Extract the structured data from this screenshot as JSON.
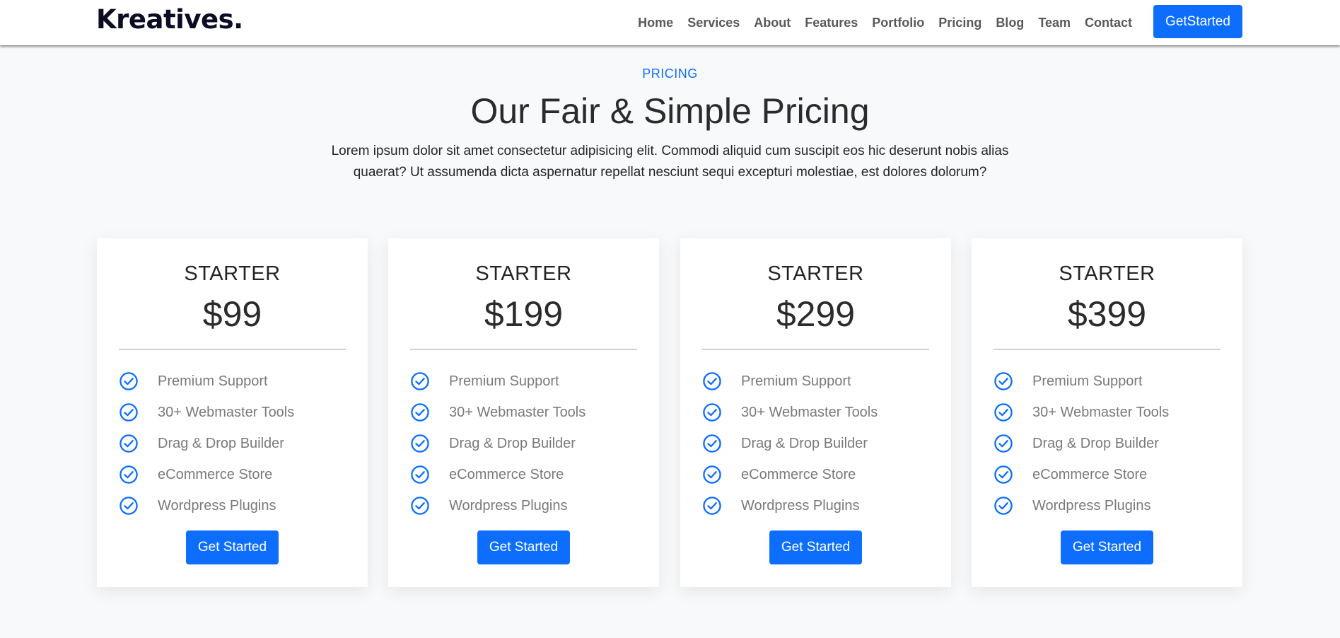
{
  "colors": {
    "accent": "#0d6efd",
    "nav_text": "#595959",
    "brand": "#0c0c24",
    "feature_text": "#7a7a7a",
    "background": "#f8f9fa"
  },
  "navbar": {
    "brand": "Kreatives.",
    "links": [
      "Home",
      "Services",
      "About",
      "Features",
      "Portfolio",
      "Pricing",
      "Blog",
      "Team",
      "Contact"
    ],
    "cta_label": "GetStarted"
  },
  "pricing": {
    "tag": "PRICING",
    "title": "Our Fair & Simple Pricing",
    "description": "Lorem ipsum dolor sit amet consectetur adipisicing elit. Commodi aliquid cum suscipit eos hic deserunt nobis alias quaerat? Ut assumenda dicta aspernatur repellat nesciunt sequi excepturi molestiae, est dolores dolorum?",
    "plans": [
      {
        "name": "STARTER",
        "price": "$99",
        "features": [
          "Premium Support",
          "30+ Webmaster Tools",
          "Drag & Drop Builder",
          "eCommerce Store",
          "Wordpress Plugins"
        ],
        "feature_icon": "check-circle-icon",
        "button_label": "Get Started"
      },
      {
        "name": "STARTER",
        "price": "$199",
        "features": [
          "Premium Support",
          "30+ Webmaster Tools",
          "Drag & Drop Builder",
          "eCommerce Store",
          "Wordpress Plugins"
        ],
        "feature_icon": "check-circle-icon",
        "button_label": "Get Started"
      },
      {
        "name": "STARTER",
        "price": "$299",
        "features": [
          "Premium Support",
          "30+ Webmaster Tools",
          "Drag & Drop Builder",
          "eCommerce Store",
          "Wordpress Plugins"
        ],
        "feature_icon": "check-circle-icon",
        "button_label": "Get Started"
      },
      {
        "name": "STARTER",
        "price": "$399",
        "features": [
          "Premium Support",
          "30+ Webmaster Tools",
          "Drag & Drop Builder",
          "eCommerce Store",
          "Wordpress Plugins"
        ],
        "feature_icon": "check-circle-icon",
        "button_label": "Get Started"
      }
    ]
  }
}
